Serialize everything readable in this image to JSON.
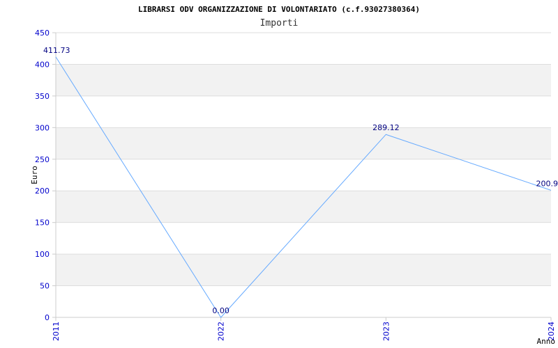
{
  "chart_data": {
    "type": "line",
    "title": "LIBRARSI ODV ORGANIZZAZIONE DI VOLONTARIATO (c.f.93027380364)",
    "subtitle": "Importi",
    "xlabel": "Anno",
    "ylabel": "Euro",
    "categories": [
      "2011",
      "2022",
      "2023",
      "2024"
    ],
    "series": [
      {
        "values": [
          411.73,
          0.0,
          289.12,
          200.9
        ]
      }
    ],
    "data_labels": [
      "411.73",
      "0.00",
      "289.12",
      "200.9"
    ],
    "ylim": [
      0,
      450
    ],
    "yticks": [
      0,
      50,
      100,
      150,
      200,
      250,
      300,
      350,
      400,
      450
    ],
    "ytick_labels": [
      "0",
      "50",
      "100",
      "150",
      "200",
      "250",
      "300",
      "350",
      "400",
      "450"
    ],
    "grid": true,
    "grid_style": "alternating-bands",
    "colors": {
      "line": "#66aaff",
      "tick_text": "#0000cc",
      "data_label": "#000080",
      "band": "#f2f2f2",
      "grid": "#dddddd",
      "axis": "#cccccc"
    }
  }
}
